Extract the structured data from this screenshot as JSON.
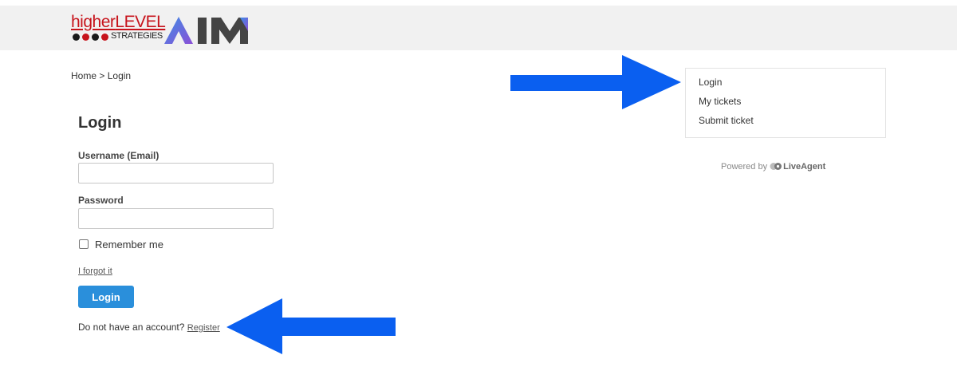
{
  "brand": {
    "logo_hl_main_lower": "higher",
    "logo_hl_main_upper": "LEVEL",
    "logo_hl_sub": "STRATEGIES",
    "logo_aim": "AIM",
    "dot_colors": [
      "#1a1a1a",
      "#c7141c",
      "#1a1a1a",
      "#c7141c"
    ],
    "aim_gradient": [
      "#3e8ee6",
      "#8a4fd6"
    ],
    "aim_dark": "#444444"
  },
  "breadcrumb": {
    "home": "Home",
    "separator": ">",
    "current": "Login"
  },
  "form": {
    "title": "Login",
    "username_label": "Username (Email)",
    "username_value": "",
    "password_label": "Password",
    "password_value": "",
    "remember_label": "Remember me",
    "remember_checked": false,
    "forgot_link": "I forgot it",
    "submit_label": "Login",
    "no_account_text": "Do not have an account?",
    "register_link": "Register"
  },
  "side_menu": {
    "items": [
      {
        "label": "Login"
      },
      {
        "label": "My tickets"
      },
      {
        "label": "Submit ticket"
      }
    ]
  },
  "footer": {
    "powered_by": "Powered by",
    "powered_brand": "LiveAgent"
  },
  "annotations": {
    "arrow_color": "#0a5ff0"
  }
}
